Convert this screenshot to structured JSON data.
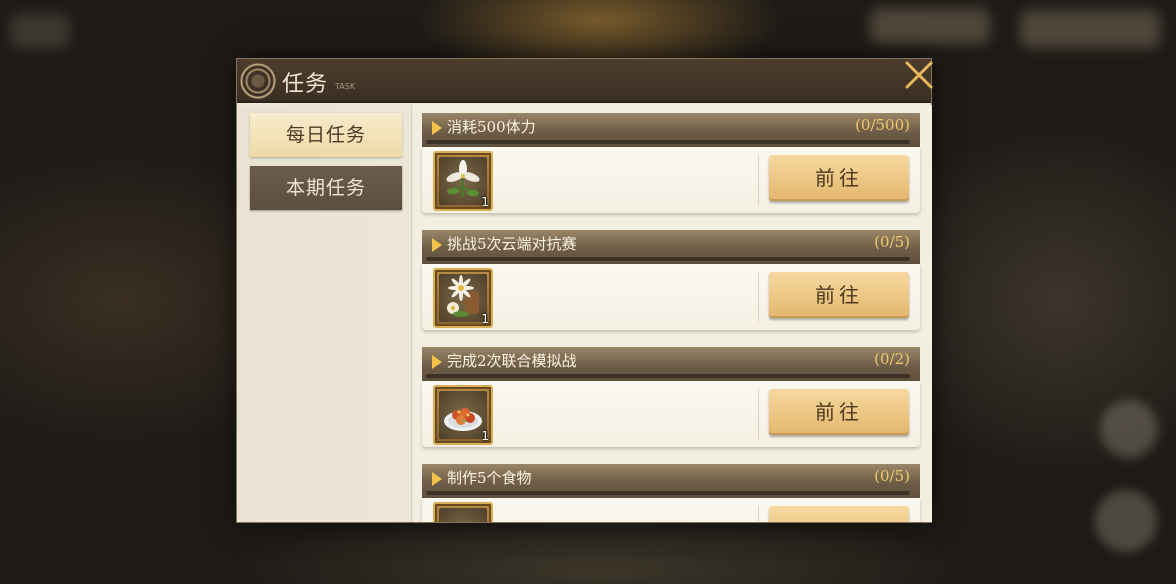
{
  "panel": {
    "title": "任务",
    "subtitle": "TASK",
    "close_icon": "close-x-icon"
  },
  "sidebar": {
    "tabs": [
      {
        "label": "每日任务",
        "active": true
      },
      {
        "label": "本期任务",
        "active": false
      }
    ]
  },
  "tasks": [
    {
      "name": "消耗500体力",
      "progress": "(0/500)",
      "reward_icon": "white-lily-icon",
      "reward_qty": "1",
      "button": "前往"
    },
    {
      "name": "挑战5次云端对抗赛",
      "progress": "(0/5)",
      "reward_icon": "chrysanthemum-bouquet-icon",
      "reward_qty": "1",
      "button": "前往"
    },
    {
      "name": "完成2次联合模拟战",
      "progress": "(0/2)",
      "reward_icon": "food-plate-icon",
      "reward_qty": "1",
      "button": "前往"
    },
    {
      "name": "制作5个食物",
      "progress": "(0/5)",
      "reward_icon": "reward-icon",
      "reward_qty": "",
      "button": ""
    }
  ],
  "colors": {
    "accent_gold": "#f2c24a",
    "progress_text": "#f2c96a",
    "button_fill": "#e3b66c"
  }
}
